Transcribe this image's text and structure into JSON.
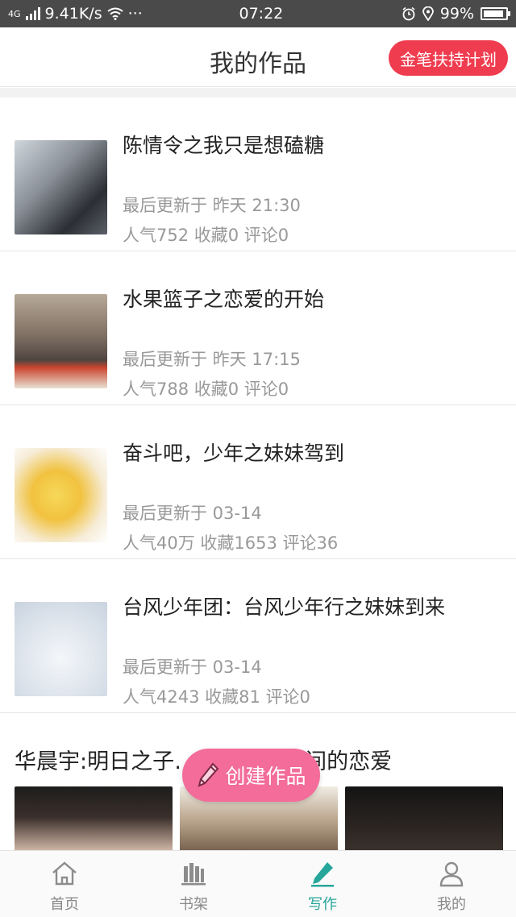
{
  "status_bar": {
    "network": "4G",
    "speed": "9.41K/s",
    "more": "···",
    "time": "07:22",
    "battery": "99%"
  },
  "header": {
    "title": "我的作品",
    "plan_button": "金笔扶持计划"
  },
  "works": [
    {
      "title": "陈情令之我只是想磕糖",
      "updated": "最后更新于 昨天 21:30",
      "stats": "人气752 收藏0 评论0"
    },
    {
      "title": "水果篮子之恋爱的开始",
      "updated": "最后更新于 昨天 17:15",
      "stats": "人气788 收藏0 评论0"
    },
    {
      "title": "奋斗吧，少年之妹妹驾到",
      "updated": "最后更新于 03-14",
      "stats": "人气40万 收藏1653 评论36"
    },
    {
      "title": "台风少年团：台风少年行之妹妹到来",
      "updated": "最后更新于 03-14",
      "stats": "人气4243 收藏81 评论0"
    }
  ],
  "recommend": {
    "title": "华晨宇:明日之子……与……之间的恋爱"
  },
  "create_button": "创建作品",
  "tabs": [
    {
      "label": "首页",
      "icon": "home-icon"
    },
    {
      "label": "书架",
      "icon": "bookshelf-icon"
    },
    {
      "label": "写作",
      "icon": "write-icon"
    },
    {
      "label": "我的",
      "icon": "profile-icon"
    }
  ],
  "colors": {
    "accent_red": "#f03c4f",
    "create_pink": "#f36c9a",
    "active_tab": "#26a69a",
    "status_bar": "#4a4a4a"
  }
}
